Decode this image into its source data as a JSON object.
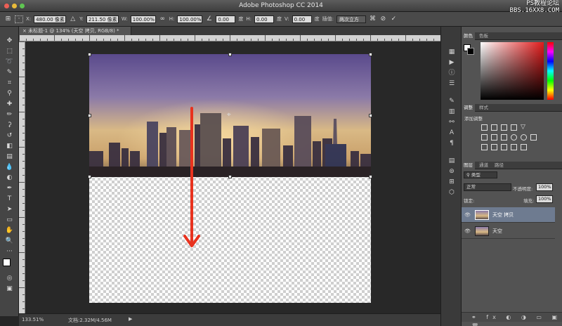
{
  "window": {
    "title": "Adobe Photoshop CC 2014"
  },
  "watermark": {
    "line1": "PS教程论坛",
    "line2": "BBS.16XX8.COM"
  },
  "options": {
    "x_label": "X:",
    "x_value": "480.00 像素",
    "y_label": "Y:",
    "y_value": "211.50 像素",
    "w_label": "W:",
    "w_value": "100.00%",
    "h_label": "H:",
    "h_value": "100.00%",
    "angle_value": "0.00",
    "angle_unit": "度",
    "hskew_label": "H:",
    "hskew_value": "0.00",
    "hskew_unit": "度",
    "vskew_label": "V:",
    "vskew_value": "0.00",
    "vskew_unit": "度",
    "interp_label": "插值:",
    "interp_value": "两次立方"
  },
  "document": {
    "tab_title": "未标题-1 @ 134% (天空 拷贝, RGB/8) *"
  },
  "status": {
    "zoom": "133.51%",
    "doc_size": "文档:2.32M/4.56M"
  },
  "color_panel": {
    "tabs": [
      "颜色",
      "色板"
    ],
    "hue_color": "#e21b1b"
  },
  "adjust_panel": {
    "tabs": [
      "调整",
      "样式"
    ],
    "title": "添加调整"
  },
  "layers_panel": {
    "tabs": [
      "图层",
      "通道",
      "路径"
    ],
    "filter_kind": "类型",
    "blend_mode": "正常",
    "opacity_label": "不透明度:",
    "opacity_value": "100%",
    "lock_label": "锁定:",
    "fill_label": "填充:",
    "fill_value": "100%",
    "layers": [
      {
        "name": "天空 拷贝",
        "selected": true
      },
      {
        "name": "天空",
        "selected": false
      }
    ]
  },
  "annotation": {
    "arrow_color": "#e8321e"
  }
}
